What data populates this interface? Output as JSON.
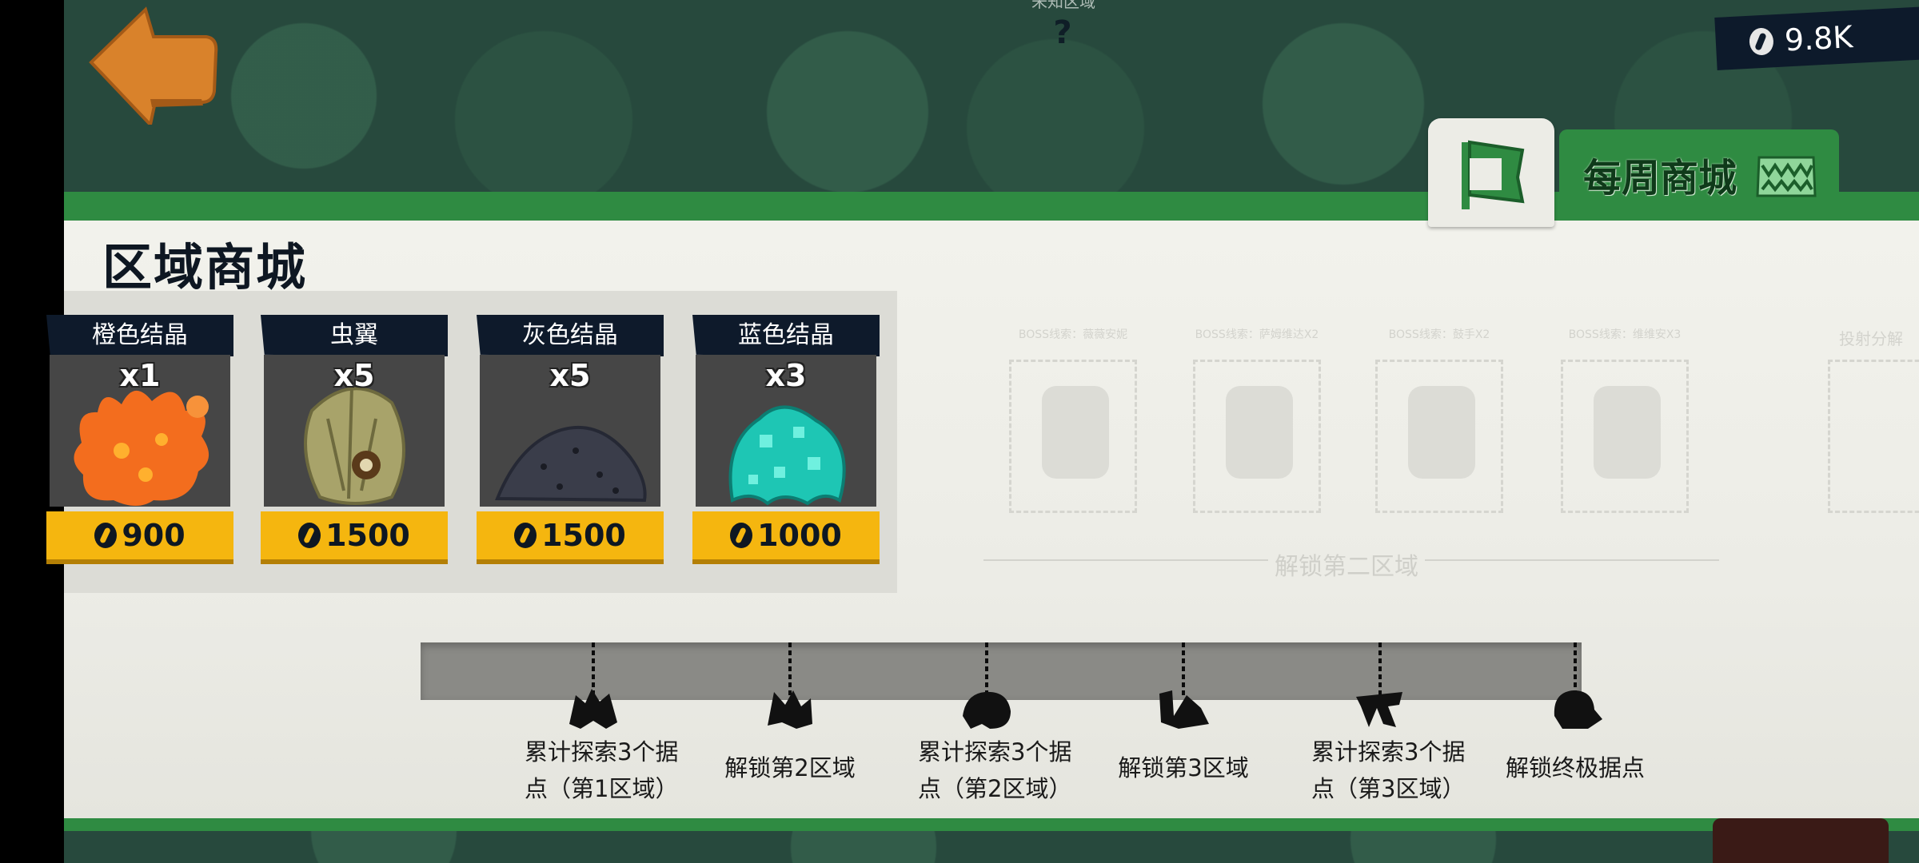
{
  "top": {
    "hint_text": "未知区域",
    "help_label": "?",
    "currency_value": "9.8K"
  },
  "tabs": {
    "weekly_shop_label": "每周商城"
  },
  "panel": {
    "title": "区域商城"
  },
  "items": [
    {
      "name": "橙色结晶",
      "qty": "x1",
      "price": "900",
      "color": "#f36d1e"
    },
    {
      "name": "虫翼",
      "qty": "x5",
      "price": "1500",
      "color": "#a8a36a"
    },
    {
      "name": "灰色结晶",
      "qty": "x5",
      "price": "1500",
      "color": "#3a3d4a"
    },
    {
      "name": "蓝色结晶",
      "qty": "x3",
      "price": "1000",
      "color": "#1ec6b4"
    }
  ],
  "locked": {
    "captions": [
      "BOSS线索：薇薇安妮",
      "BOSS线索：萨姆维达X2",
      "BOSS线索：鼓手X2",
      "BOSS线索：维维安X3"
    ],
    "unlock_text": "解锁第二区域",
    "right_edge_text": "投射分解"
  },
  "milestones": [
    {
      "label_line1": "累计探索3个据",
      "label_line2": "点（第1区域）"
    },
    {
      "label_line1": "解锁第2区域",
      "label_line2": ""
    },
    {
      "label_line1": "累计探索3个据",
      "label_line2": "点（第2区域）"
    },
    {
      "label_line1": "解锁第3区域",
      "label_line2": ""
    },
    {
      "label_line1": "累计探索3个据",
      "label_line2": "点（第3区域）"
    },
    {
      "label_line1": "解锁终极据点",
      "label_line2": ""
    }
  ],
  "icons": {
    "back": "back-arrow-icon",
    "help": "question-icon",
    "currency": "coin-icon",
    "flag": "flag-icon",
    "weekly": "monster-icon"
  },
  "colors": {
    "accent_green": "#2f8b42",
    "price_yellow": "#f5b60f",
    "header_navy": "#0e1a2b",
    "background": "#27493d"
  }
}
